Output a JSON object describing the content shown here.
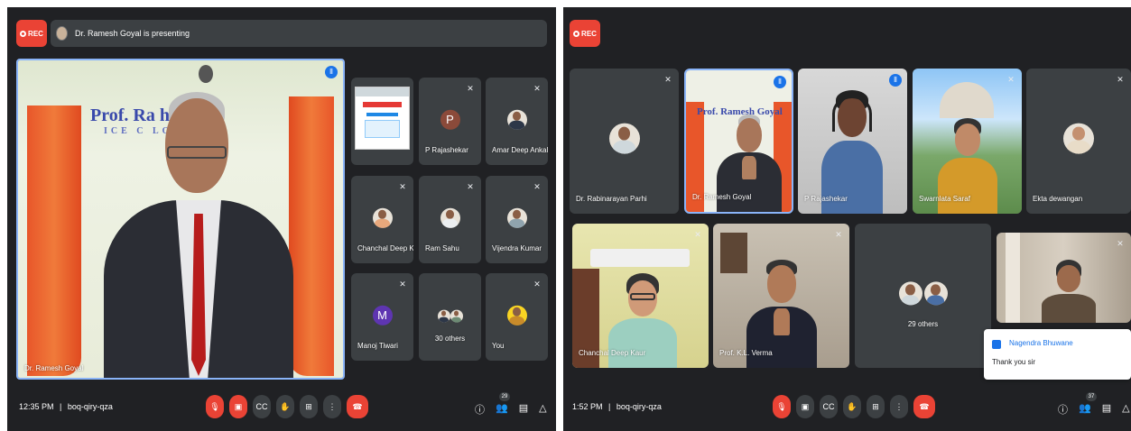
{
  "left": {
    "rec_label": "REC",
    "presenting_text": "Dr. Ramesh Goyal is presenting",
    "main_tile": {
      "name": "Dr. Ramesh Goyal",
      "banner_text": "Prof. Ra    h Goyal",
      "banner_sub": "ICE C   LOR"
    },
    "tiles": [
      {
        "name": ""
      },
      {
        "name": "P Rajashekar",
        "initial": "P",
        "color": "#8b4a3a"
      },
      {
        "name": "Amar Deep Ankalgi"
      },
      {
        "name": "Chanchal Deep Ka..."
      },
      {
        "name": "Ram Sahu"
      },
      {
        "name": "Vijendra Kumar"
      },
      {
        "name": "Manoj Tiwari",
        "initial": "M",
        "color": "#5e35b1"
      },
      {
        "name": "30 others"
      },
      {
        "name": "You"
      }
    ],
    "time": "12:35 PM",
    "separator": "|",
    "meeting_code": "boq-qiry-qza",
    "people_count": "29"
  },
  "right": {
    "rec_label": "REC",
    "tiles": [
      {
        "name": "Dr. Rabinarayan Parhi"
      },
      {
        "name": "Dr. Ramesh Goyal",
        "banner_text": "Prof. Ramesh Goyal"
      },
      {
        "name": "P Rajashekar"
      },
      {
        "name": "Swarnlata Saraf"
      },
      {
        "name": "Ekta dewangan"
      },
      {
        "name": "Chanchal Deep Kaur"
      },
      {
        "name": "Prof. K.L. Verma"
      },
      {
        "name": "29 others"
      },
      {
        "name": ""
      }
    ],
    "chat": {
      "sender": "Nagendra Bhuwane",
      "message": "Thank you sir"
    },
    "time": "1:52 PM",
    "separator": "|",
    "meeting_code": "boq-qiry-qza",
    "people_count": "37"
  },
  "colors": {
    "background": "#202124",
    "tile": "#3c4043",
    "red": "#ea4335",
    "blue": "#1a73e8"
  },
  "icons": {
    "rec": "record-dot-icon",
    "mic_off": "mic-off-icon",
    "speaking": "speaking-indicator-icon",
    "camera_off": "camera-off-icon",
    "captions": "captions-icon",
    "raise_hand": "raise-hand-icon",
    "present": "present-screen-icon",
    "more": "more-vert-icon",
    "end_call": "end-call-icon",
    "info": "info-icon",
    "people": "people-icon",
    "chat": "chat-icon",
    "activities": "activities-icon"
  }
}
